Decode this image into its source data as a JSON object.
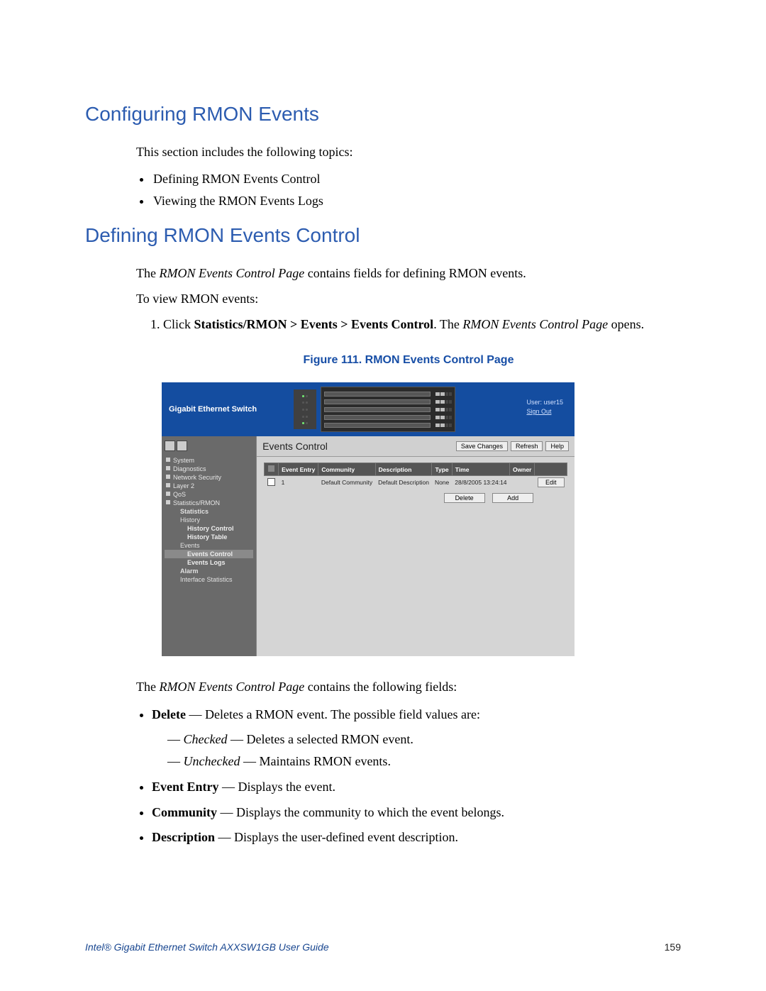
{
  "heading1": "Configuring RMON Events",
  "intro": "This section includes the following topics:",
  "topics": [
    "Defining RMON Events Control",
    "Viewing the RMON Events Logs"
  ],
  "heading2": "Defining RMON Events Control",
  "para2_prefix": "The ",
  "para2_italic": "RMON Events Control Page",
  "para2_suffix": " contains fields for defining RMON events.",
  "para3": "To view RMON events:",
  "step1_a": "Click ",
  "step1_b": "Statistics/RMON > Events > Events Control",
  "step1_c": ". The ",
  "step1_d": "RMON Events Control Page",
  "step1_e": " opens.",
  "figcaption": "Figure 111. RMON Events Control Page",
  "para4_prefix": "The ",
  "para4_italic": "RMON Events Control Page",
  "para4_suffix": " contains the following fields:",
  "fields": {
    "delete_label": "Delete",
    "delete_desc": " — Deletes a RMON event. The possible field values are:",
    "delete_sub": [
      {
        "em": "Checked",
        "rest": " — Deletes a selected RMON event."
      },
      {
        "em": "Unchecked",
        "rest": " — Maintains RMON events."
      }
    ],
    "event_entry_label": "Event Entry",
    "event_entry_desc": " — Displays the event.",
    "community_label": "Community",
    "community_desc": " — Displays the community to which the event belongs.",
    "description_label": "Description",
    "description_desc": " — Displays the user-defined event description."
  },
  "footer_left": "Intel® Gigabit Ethernet Switch AXXSW1GB User Guide",
  "footer_right": "159",
  "screenshot": {
    "brand": "Gigabit Ethernet Switch",
    "user": "User: user15",
    "signout": "Sign Out",
    "nav": {
      "system": "System",
      "diagnostics": "Diagnostics",
      "network_security": "Network Security",
      "layer2": "Layer 2",
      "qos": "QoS",
      "stats_rmon": "Statistics/RMON",
      "statistics": "Statistics",
      "history": "History",
      "history_control": "History Control",
      "history_table": "History Table",
      "events": "Events",
      "events_control": "Events Control",
      "events_logs": "Events Logs",
      "alarm": "Alarm",
      "interface_stats": "Interface Statistics"
    },
    "panel_title": "Events Control",
    "buttons": {
      "save_changes": "Save Changes",
      "refresh": "Refresh",
      "help": "Help",
      "delete": "Delete",
      "add": "Add",
      "edit": "Edit"
    },
    "columns": {
      "chk": "",
      "event_entry": "Event Entry",
      "community": "Community",
      "description": "Description",
      "type": "Type",
      "time": "Time",
      "owner": "Owner"
    },
    "row": {
      "entry": "1",
      "community": "Default Community",
      "description": "Default Description",
      "type": "None",
      "time": "28/8/2005 13:24:14",
      "owner": ""
    }
  }
}
